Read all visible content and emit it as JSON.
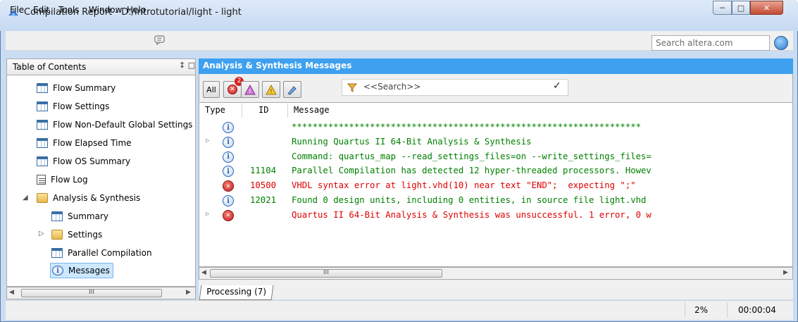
{
  "window": {
    "title": "Compilation Report - D:/introtutorial/light - light"
  },
  "menu": {
    "items": [
      "File",
      "Edit",
      "Tools",
      "Window",
      "Help"
    ],
    "search_placeholder": "Search altera.com"
  },
  "toc": {
    "header": "Table of Contents",
    "pin_glyph": "↕ □",
    "items": [
      {
        "label": "Flow Summary",
        "icon": "table-icon"
      },
      {
        "label": "Flow Settings",
        "icon": "table-icon"
      },
      {
        "label": "Flow Non-Default Global Settings",
        "icon": "table-icon"
      },
      {
        "label": "Flow Elapsed Time",
        "icon": "table-icon"
      },
      {
        "label": "Flow OS Summary",
        "icon": "table-icon"
      },
      {
        "label": "Flow Log",
        "icon": "document-icon"
      },
      {
        "label": "Analysis & Synthesis",
        "icon": "folder-icon",
        "expanded": true
      },
      {
        "label": "Summary",
        "icon": "table-icon"
      },
      {
        "label": "Settings",
        "icon": "folder-icon",
        "expanded": false
      },
      {
        "label": "Parallel Compilation",
        "icon": "table-icon"
      },
      {
        "label": "Messages",
        "icon": "info-icon",
        "selected": true
      }
    ],
    "scroll_thumb": "III"
  },
  "messages": {
    "header": "Analysis & Synthesis Messages",
    "toolbar": {
      "all_label": "All",
      "error_count": "2",
      "search_placeholder": "<<Search>>"
    },
    "columns": [
      "Type",
      "ID",
      "Message"
    ],
    "rows": [
      {
        "type": "info",
        "expandable": false,
        "id": "",
        "text": "*******************************************************************",
        "color": "#008000"
      },
      {
        "type": "info",
        "expandable": true,
        "id": "",
        "text": "Running Quartus II 64-Bit Analysis & Synthesis",
        "color": "#008000"
      },
      {
        "type": "info",
        "expandable": false,
        "id": "",
        "text": "Command: quartus_map --read_settings_files=on --write_settings_files=",
        "color": "#008000"
      },
      {
        "type": "info",
        "expandable": false,
        "id": "11104",
        "text": "Parallel Compilation has detected 12 hyper-threaded processors. Howev",
        "color": "#008000"
      },
      {
        "type": "error",
        "expandable": false,
        "id": "10500",
        "text": "VHDL syntax error at light.vhd(10) near text \"END\";  expecting \";\"",
        "color": "#e00000"
      },
      {
        "type": "info",
        "expandable": false,
        "id": "12021",
        "text": "Found 0 design units, including 0 entities, in source file light.vhd",
        "color": "#008000"
      },
      {
        "type": "error",
        "expandable": true,
        "id": "",
        "text": "Quartus II 64-Bit Analysis & Synthesis was unsuccessful. 1 error, 0 w",
        "color": "#e00000"
      }
    ],
    "scroll_thumb": "III",
    "tab_label": "Processing (7)"
  },
  "status": {
    "progress": "2%",
    "elapsed": "00:00:04"
  },
  "colors": {
    "header_blue": "#3ea0ee",
    "info_green": "#008000",
    "error_red": "#e00000"
  }
}
